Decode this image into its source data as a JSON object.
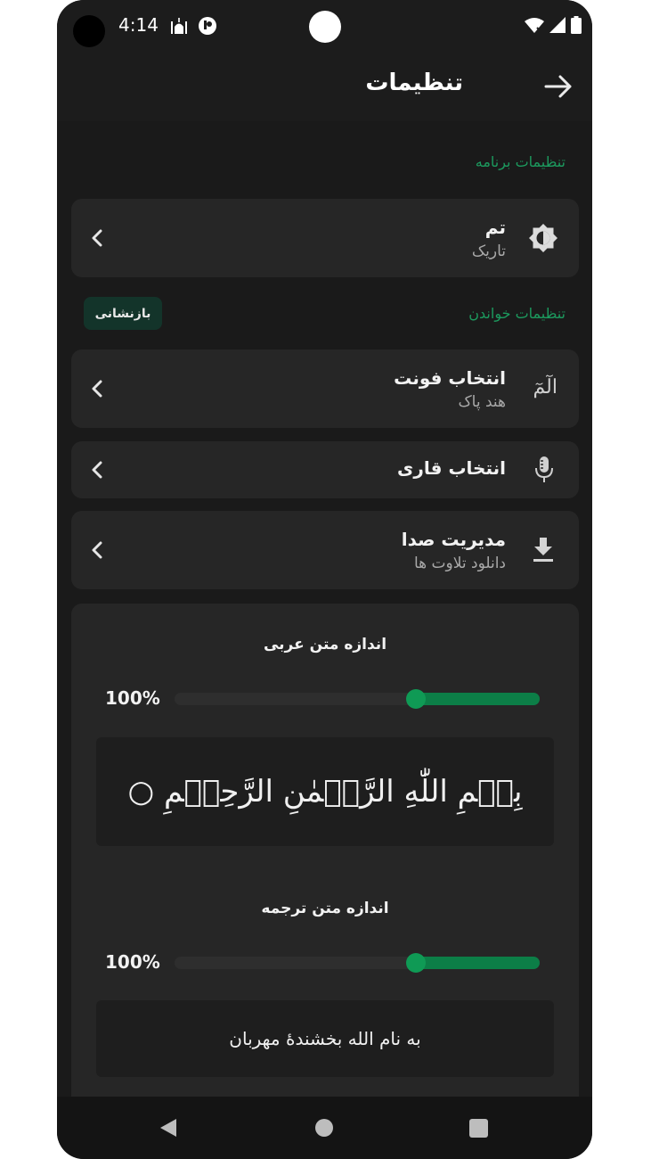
{
  "status_bar": {
    "time": "4:14"
  },
  "app_bar": {
    "title": "تنظیمات"
  },
  "sections": {
    "app_settings": "تنظیمات برنامه",
    "reading_settings": "تنظیمات خواندن",
    "reset_button": "بازنشانی"
  },
  "items": {
    "theme": {
      "title": "تم",
      "subtitle": "تاریک"
    },
    "font": {
      "title": "انتخاب فونت",
      "subtitle": "هند پاک",
      "icon_glyph": "الٓمٓ"
    },
    "reciter": {
      "title": "انتخاب قاری"
    },
    "audio": {
      "title": "مدیریت صدا",
      "subtitle": "دانلود تلاوت ها"
    }
  },
  "arabic_size": {
    "label": "اندازه متن عربی",
    "percent": "100%",
    "value": 0.34,
    "preview": "بِسۡمِ اللّٰهِ الرَّحۡمٰنِ الرَّحِيۡمِ ○"
  },
  "translation_size": {
    "label": "اندازه متن ترجمه",
    "percent": "100%",
    "value": 0.34,
    "preview": "به نام الله بخشندۀ مهربان"
  },
  "colors": {
    "accent": "#1c9a5e",
    "slider_fill": "#0c7e47",
    "card": "#262626",
    "background": "#1a1a1a"
  }
}
